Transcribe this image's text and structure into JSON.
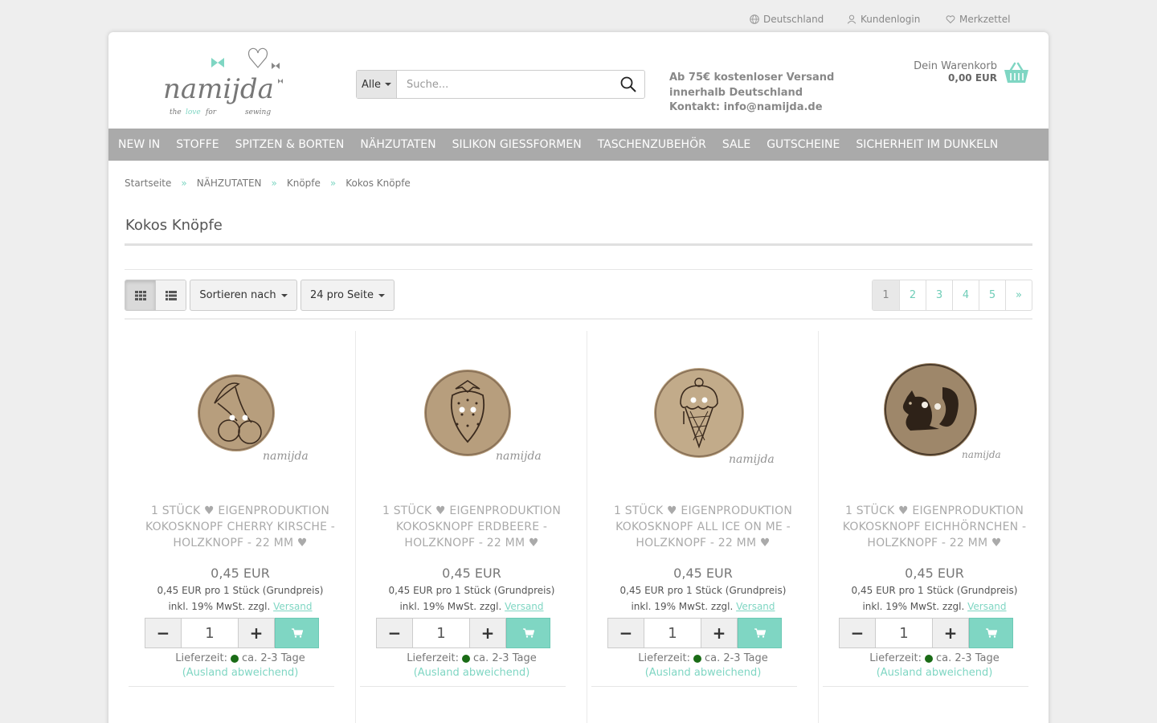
{
  "topbar": {
    "country": "Deutschland",
    "login": "Kundenlogin",
    "wishlist": "Merkzettel"
  },
  "header": {
    "search_category": "Alle",
    "search_placeholder": "Suche...",
    "info_line1": "Ab 75€ kostenloser Versand",
    "info_line2": "innerhalb Deutschland",
    "info_line3": "Kontakt: info@namijda.de",
    "cart_label": "Dein Warenkorb",
    "cart_total": "0,00 EUR"
  },
  "logo": {
    "name": "namijda",
    "tagline_the": "the",
    "tagline_love": "love",
    "tagline_for": "for",
    "tagline_sewing": "sewing"
  },
  "nav": [
    "NEW IN",
    "STOFFE",
    "SPITZEN & BORTEN",
    "NÄHZUTATEN",
    "SILIKON GIESSFORMEN",
    "TASCHENZUBEHÖR",
    "SALE",
    "GUTSCHEINE",
    "SICHERHEIT IM DUNKELN"
  ],
  "breadcrumb": {
    "items": [
      "Startseite",
      "NÄHZUTATEN",
      "Knöpfe",
      "Kokos Knöpfe"
    ],
    "separator": "»"
  },
  "page_title": "Kokos Knöpfe",
  "toolbar": {
    "sort_label": "Sortieren nach",
    "per_page_label": "24 pro Seite"
  },
  "pagination": [
    "1",
    "2",
    "3",
    "4",
    "5",
    "»"
  ],
  "colors": {
    "accent": "#7fd6c3",
    "nav_bg": "#aaaaaa",
    "in_stock": "#1a6b16"
  },
  "products": [
    {
      "name": "1 Stück ♥ EIGENPRODUKTION KOKOSKNOPF CHERRY KIRSCHE - HOLZKNOPF - 22 mm ♥",
      "motif": "cherry",
      "price": "0,45 EUR",
      "base_price": "0,45 EUR pro 1 Stück (Grundpreis)",
      "tax_text": "inkl. 19% MwSt. zzgl.",
      "shipping_link": "Versand",
      "quantity": "1",
      "delivery_label": "Lieferzeit:",
      "delivery_time": "ca. 2-3 Tage",
      "abroad_note": "(Ausland abweichend)"
    },
    {
      "name": "1 Stück ♥ EIGENPRODUKTION KOKOSKNOPF ERDBEERE - HOLZKNOPF - 22 mm ♥",
      "motif": "strawberry",
      "price": "0,45 EUR",
      "base_price": "0,45 EUR pro 1 Stück (Grundpreis)",
      "tax_text": "inkl. 19% MwSt. zzgl.",
      "shipping_link": "Versand",
      "quantity": "1",
      "delivery_label": "Lieferzeit:",
      "delivery_time": "ca. 2-3 Tage",
      "abroad_note": "(Ausland abweichend)"
    },
    {
      "name": "1 Stück ♥ EIGENPRODUKTION KOKOSKNOPF ALL ICE ON ME - HOLZKNOPF - 22 mm ♥",
      "motif": "ice-cream",
      "price": "0,45 EUR",
      "base_price": "0,45 EUR pro 1 Stück (Grundpreis)",
      "tax_text": "inkl. 19% MwSt. zzgl.",
      "shipping_link": "Versand",
      "quantity": "1",
      "delivery_label": "Lieferzeit:",
      "delivery_time": "ca. 2-3 Tage",
      "abroad_note": "(Ausland abweichend)"
    },
    {
      "name": "1 Stück ♥ EIGENPRODUKTION KOKOSKNOPF EICHHÖRNCHEN - HOLZKNOPF - 22 mm ♥",
      "motif": "squirrel",
      "price": "0,45 EUR",
      "base_price": "0,45 EUR pro 1 Stück (Grundpreis)",
      "tax_text": "inkl. 19% MwSt. zzgl.",
      "shipping_link": "Versand",
      "quantity": "1",
      "delivery_label": "Lieferzeit:",
      "delivery_time": "ca. 2-3 Tage",
      "abroad_note": "(Ausland abweichend)"
    }
  ]
}
